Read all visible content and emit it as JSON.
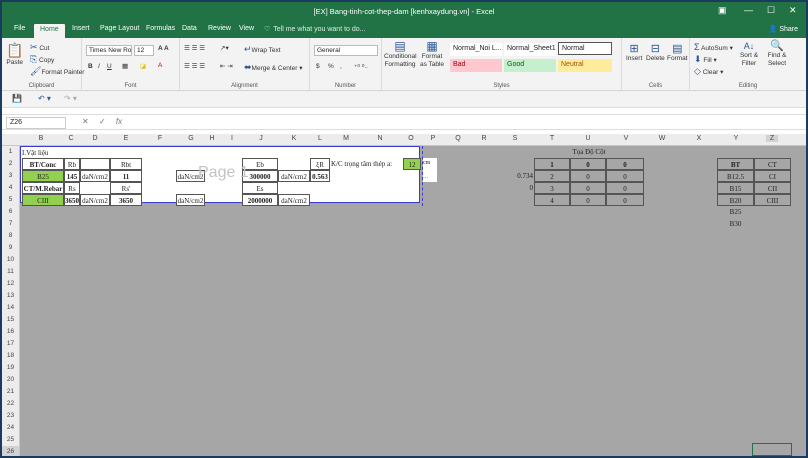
{
  "window": {
    "title": "[EX] Bang-tinh-cot-thep-dam [kenhxaydung.vn] - Excel",
    "controls": [
      "▣",
      "—",
      "☐",
      "✕"
    ]
  },
  "tabs": [
    "File",
    "Home",
    "Insert",
    "Page Layout",
    "Formulas",
    "Data",
    "Review",
    "View"
  ],
  "active_tab": "Home",
  "tell_me": "Tell me what you want to do...",
  "share": "Share",
  "ribbon": {
    "clipboard": {
      "paste": "Paste",
      "cut": "Cut",
      "copy": "Copy",
      "format_painter": "Format Painter",
      "label": "Clipboard"
    },
    "font": {
      "name": "Times New Ro",
      "size": "12",
      "label": "Font",
      "buttons": [
        "B",
        "I",
        "U"
      ]
    },
    "alignment": {
      "wrap": "Wrap Text",
      "merge": "Merge & Center",
      "label": "Alignment"
    },
    "number": {
      "format": "General",
      "label": "Number",
      "buttons": [
        "$",
        "%",
        ","
      ]
    },
    "styles": {
      "conditional": "Conditional Formatting",
      "format_table": "Format as Table",
      "cells": [
        {
          "label": "Normal_Noi L...",
          "bg": "#ffffff",
          "fg": "#222222"
        },
        {
          "label": "Normal_Sheet1",
          "bg": "#ffffff",
          "fg": "#222222"
        },
        {
          "label": "Normal",
          "bg": "#ffffff",
          "fg": "#222222"
        },
        {
          "label": "Bad",
          "bg": "#ffc7ce",
          "fg": "#9c0006"
        },
        {
          "label": "Good",
          "bg": "#c6efce",
          "fg": "#006100"
        },
        {
          "label": "Neutral",
          "bg": "#ffeb9c",
          "fg": "#9c5700"
        }
      ],
      "label": "Styles"
    },
    "cells": {
      "insert": "Insert",
      "delete": "Delete",
      "format": "Format",
      "label": "Cells"
    },
    "editing": {
      "autosum": "AutoSum",
      "fill": "Fill",
      "clear": "Clear",
      "sort": "Sort & Filter",
      "find": "Find & Select",
      "label": "Editing"
    }
  },
  "name_box": "Z26",
  "fx": "fx",
  "columns": [
    "B",
    "C",
    "D",
    "E",
    "F",
    "G",
    "H",
    "I",
    "J",
    "K",
    "L",
    "M",
    "N",
    "O",
    "P",
    "Q",
    "R",
    "S",
    "T",
    "U",
    "V",
    "W",
    "X",
    "Y",
    "Z"
  ],
  "rows": [
    "1",
    "2",
    "3",
    "4",
    "5",
    "6",
    "7",
    "8",
    "9",
    "10",
    "11",
    "12",
    "13",
    "14",
    "15",
    "16",
    "17",
    "18",
    "19",
    "20",
    "21",
    "22",
    "23",
    "24",
    "25",
    "26"
  ],
  "sheet": {
    "title": "I.Vật liệu",
    "bt_conc": "BT/Conc",
    "rb": "Rb",
    "rbt": "Rbt",
    "b25": "B25",
    "v145": "145",
    "dancm2": "daN/cm2",
    "v11": "11",
    "ct_rebar": "CT/M.Rebar",
    "rs": "Rs",
    "rs2": "Rs'",
    "ciii": "CIII",
    "v3650": "3650",
    "eb": "Eb",
    "v300000": "300000",
    "es": "Es",
    "v2000000": "2000000",
    "xir": "ξR",
    "v0563": "0.563",
    "kc": "K/C trọng tâm thép a:",
    "v12": "12",
    "cm": "cm",
    "dots": "...",
    "v0734": "0.734",
    "v0": "0",
    "toa_do": "Tọa Độ Cột",
    "table_t": [
      "1",
      "2",
      "3",
      "4"
    ],
    "table_u": [
      "0",
      "0",
      "0",
      "0"
    ],
    "table_v": [
      "0",
      "0",
      "0",
      "0"
    ],
    "bt_list": [
      "BT",
      "B12.5",
      "B15",
      "B20",
      "B25",
      "B30"
    ],
    "ct_list": [
      "CT",
      "CI",
      "CII",
      "CIII"
    ]
  },
  "watermark": "Page 1"
}
